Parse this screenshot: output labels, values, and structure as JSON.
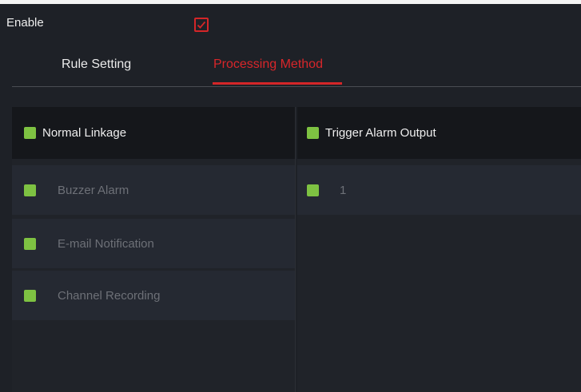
{
  "enable": {
    "label": "Enable",
    "checked": true
  },
  "tabs": [
    {
      "label": "Rule Setting",
      "active": false
    },
    {
      "label": "Processing Method",
      "active": true
    }
  ],
  "normal_linkage": {
    "title": "Normal Linkage",
    "items": [
      {
        "label": "Buzzer Alarm",
        "checked": true
      },
      {
        "label": "E-mail Notification",
        "checked": true
      },
      {
        "label": "Channel Recording",
        "checked": true
      }
    ]
  },
  "trigger_alarm_output": {
    "title": "Trigger Alarm Output",
    "items": [
      {
        "label": "1",
        "checked": true
      }
    ]
  },
  "colors": {
    "accent_red": "#d42628",
    "check_green": "#7ec242",
    "background": "#1e2127"
  }
}
